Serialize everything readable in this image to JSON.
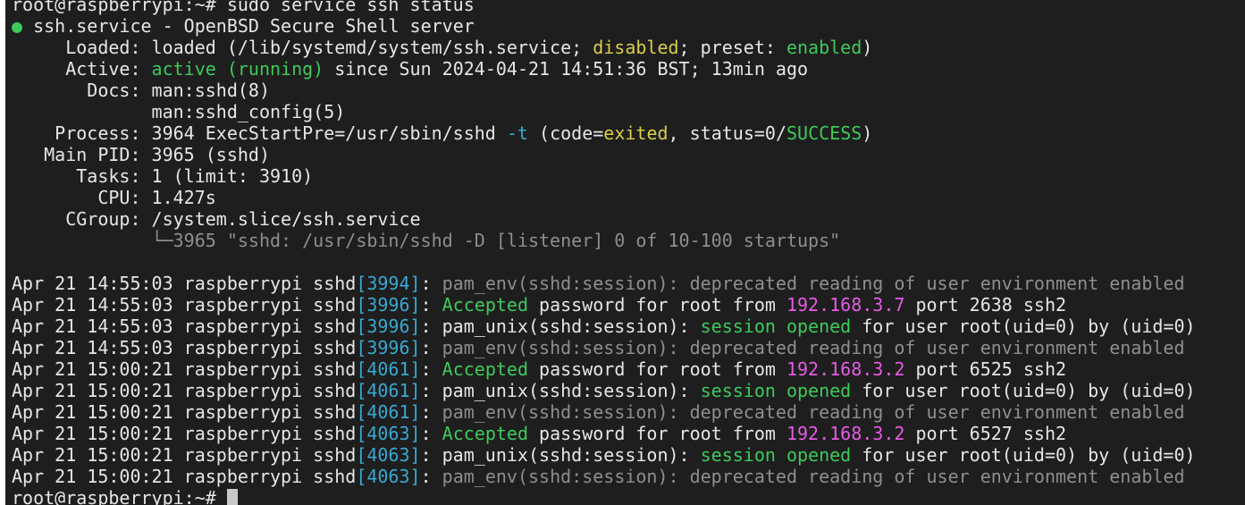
{
  "terminal": {
    "lines": [
      [
        {
          "t": "root@raspberrypi:~# sudo service ssh status"
        }
      ],
      [
        {
          "t": "●",
          "c": "green",
          "name": "status-dot-icon"
        },
        {
          "t": " ssh.service - OpenBSD Secure Shell server"
        }
      ],
      [
        {
          "t": "     Loaded: loaded (/lib/systemd/system/ssh.service; "
        },
        {
          "t": "disabled",
          "c": "yellow"
        },
        {
          "t": "; preset: "
        },
        {
          "t": "enabled",
          "c": "green"
        },
        {
          "t": ")"
        }
      ],
      [
        {
          "t": "     Active: "
        },
        {
          "t": "active (running)",
          "c": "green"
        },
        {
          "t": " since Sun 2024-04-21 14:51:36 BST; 13min ago"
        }
      ],
      [
        {
          "t": "       Docs: man:sshd(8)"
        }
      ],
      [
        {
          "t": "             man:sshd_config(5)"
        }
      ],
      [
        {
          "t": "    Process: 3964 ExecStartPre=/usr/sbin/sshd "
        },
        {
          "t": "-t",
          "c": "cyan"
        },
        {
          "t": " (code="
        },
        {
          "t": "exited",
          "c": "yellow"
        },
        {
          "t": ", status=0/"
        },
        {
          "t": "SUCCESS",
          "c": "green"
        },
        {
          "t": ")"
        }
      ],
      [
        {
          "t": "   Main PID: 3965 (sshd)"
        }
      ],
      [
        {
          "t": "      Tasks: 1 (limit: 3910)"
        }
      ],
      [
        {
          "t": "        CPU: 1.427s"
        }
      ],
      [
        {
          "t": "     CGroup: /system.slice/ssh.service"
        }
      ],
      [
        {
          "t": "             └─3965 \"sshd: /usr/sbin/sshd -D [listener] 0 of 10-100 startups\"",
          "c": "gray"
        }
      ],
      [
        {
          "t": ""
        }
      ],
      [
        {
          "t": "Apr 21 14:55:03 raspberrypi sshd"
        },
        {
          "t": "[3994]",
          "c": "cyan"
        },
        {
          "t": ": "
        },
        {
          "t": "pam_env(sshd:session): deprecated reading of user environment enabled",
          "c": "gray"
        }
      ],
      [
        {
          "t": "Apr 21 14:55:03 raspberrypi sshd"
        },
        {
          "t": "[3996]",
          "c": "cyan"
        },
        {
          "t": ": "
        },
        {
          "t": "Accepted",
          "c": "green"
        },
        {
          "t": " password for root from "
        },
        {
          "t": "192.168.3.7",
          "c": "magenta"
        },
        {
          "t": " port 2638 ssh2"
        }
      ],
      [
        {
          "t": "Apr 21 14:55:03 raspberrypi sshd"
        },
        {
          "t": "[3996]",
          "c": "cyan"
        },
        {
          "t": ": pam_unix(sshd:session): "
        },
        {
          "t": "session opened",
          "c": "green"
        },
        {
          "t": " for user root(uid=0) by (uid=0)"
        }
      ],
      [
        {
          "t": "Apr 21 14:55:03 raspberrypi sshd"
        },
        {
          "t": "[3996]",
          "c": "cyan"
        },
        {
          "t": ": "
        },
        {
          "t": "pam_env(sshd:session): deprecated reading of user environment enabled",
          "c": "gray"
        }
      ],
      [
        {
          "t": "Apr 21 15:00:21 raspberrypi sshd"
        },
        {
          "t": "[4061]",
          "c": "cyan"
        },
        {
          "t": ": "
        },
        {
          "t": "Accepted",
          "c": "green"
        },
        {
          "t": " password for root from "
        },
        {
          "t": "192.168.3.2",
          "c": "magenta"
        },
        {
          "t": " port 6525 ssh2"
        }
      ],
      [
        {
          "t": "Apr 21 15:00:21 raspberrypi sshd"
        },
        {
          "t": "[4061]",
          "c": "cyan"
        },
        {
          "t": ": pam_unix(sshd:session): "
        },
        {
          "t": "session opened",
          "c": "green"
        },
        {
          "t": " for user root(uid=0) by (uid=0)"
        }
      ],
      [
        {
          "t": "Apr 21 15:00:21 raspberrypi sshd"
        },
        {
          "t": "[4061]",
          "c": "cyan"
        },
        {
          "t": ": "
        },
        {
          "t": "pam_env(sshd:session): deprecated reading of user environment enabled",
          "c": "gray"
        }
      ],
      [
        {
          "t": "Apr 21 15:00:21 raspberrypi sshd"
        },
        {
          "t": "[4063]",
          "c": "cyan"
        },
        {
          "t": ": "
        },
        {
          "t": "Accepted",
          "c": "green"
        },
        {
          "t": " password for root from "
        },
        {
          "t": "192.168.3.2",
          "c": "magenta"
        },
        {
          "t": " port 6527 ssh2"
        }
      ],
      [
        {
          "t": "Apr 21 15:00:21 raspberrypi sshd"
        },
        {
          "t": "[4063]",
          "c": "cyan"
        },
        {
          "t": ": pam_unix(sshd:session): "
        },
        {
          "t": "session opened",
          "c": "green"
        },
        {
          "t": " for user root(uid=0) by (uid=0)"
        }
      ],
      [
        {
          "t": "Apr 21 15:00:21 raspberrypi sshd"
        },
        {
          "t": "[4063]",
          "c": "cyan"
        },
        {
          "t": ": "
        },
        {
          "t": "pam_env(sshd:session): deprecated reading of user environment enabled",
          "c": "gray"
        }
      ],
      [
        {
          "t": "root@raspberrypi:~# "
        },
        {
          "cursor": true
        }
      ]
    ]
  }
}
